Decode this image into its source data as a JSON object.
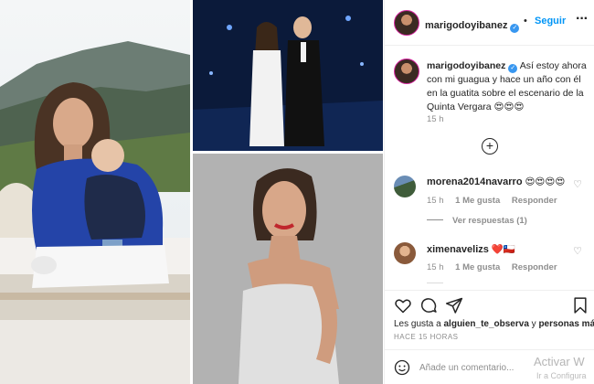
{
  "post": {
    "author": "marigodoyibanez",
    "follow_label": "Seguir",
    "separator": "•",
    "more_label": "···"
  },
  "caption": {
    "username": "marigodoyibanez",
    "text": "Así estoy ahora con mi guagua y hace un año con él en la guatita sobre el escenario de la Quinta Vergara 😍😍😍",
    "time": "15 h"
  },
  "comments": [
    {
      "username": "morena2014navarro",
      "text": "😍😍😍😍",
      "time": "15 h",
      "likes": "1 Me gusta",
      "reply": "Responder",
      "view_replies": "Ver respuestas (1)"
    },
    {
      "username": "ximenavelizs",
      "text": "❤️🇨🇱",
      "time": "15 h",
      "likes": "1 Me gusta",
      "reply": "Responder"
    }
  ],
  "likes": {
    "prefix": "Les gusta a",
    "user": "alguien_te_observa",
    "connector": "y",
    "others": "personas más"
  },
  "post_time": "HACE 15 HORAS",
  "add_comment": {
    "placeholder": "Añade un comentario..."
  },
  "watermark": {
    "line1": "Activar W",
    "line2": "Ir a Configura"
  },
  "icons": {
    "verified": "verified-badge-icon",
    "heart": "heart-icon",
    "comment": "comment-icon",
    "share": "share-icon",
    "save": "bookmark-icon",
    "emoji": "emoji-icon",
    "load_more": "plus-circle-icon"
  },
  "colors": {
    "follow_blue": "#0095f6",
    "verified_blue": "#3897f0",
    "secondary_text": "#8e8e8e",
    "primary_text": "#262626"
  }
}
